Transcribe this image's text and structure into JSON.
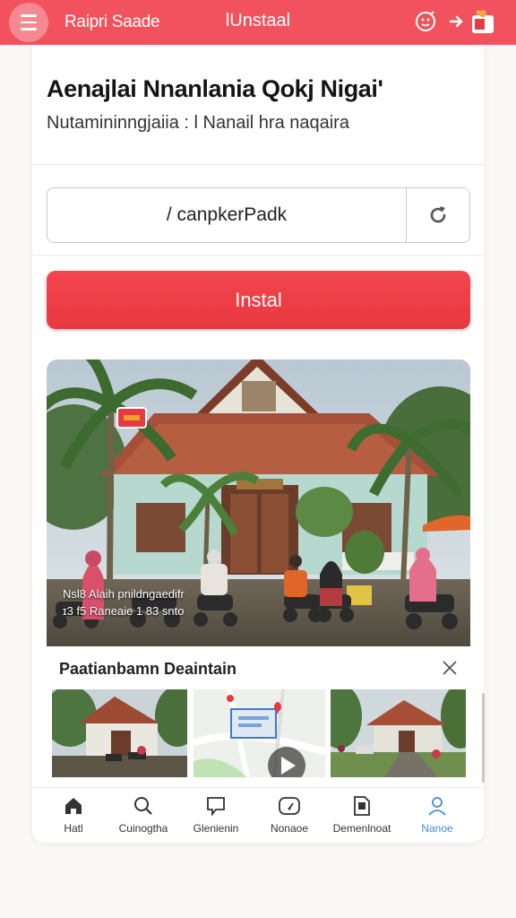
{
  "topbar": {
    "brand": "Raipri Saade",
    "title": "lUnstaal",
    "accent": "#f1525e",
    "icons": [
      "menu-icon",
      "assistant-icon",
      "share-arrow-icon",
      "gift-icon"
    ]
  },
  "headline": "Aenajlai Nnanlania Qokj Nigai'",
  "subhead": "Nutamininngjaiia : l Nanail hra naqaira",
  "code_field": {
    "value": "/ canpkerPadk",
    "refresh_icon": "refresh-icon"
  },
  "install_button": "Instal",
  "hero": {
    "sign_badge": "",
    "caption_line1": "Nsl8 Alaih pnildngaedifr",
    "caption_line2": "ɪ3 f5 Raneaie 1 83 snto"
  },
  "gallery": {
    "title": "Paatianbamn Deaintain",
    "close_icon": "close-icon",
    "thumbnails": [
      "house-photo",
      "map-with-play-icon",
      "street-photo"
    ]
  },
  "bottom_nav": [
    {
      "label": "Hatl",
      "icon": "home-icon",
      "active": false
    },
    {
      "label": "Cuinogtha",
      "icon": "search-icon",
      "active": false
    },
    {
      "label": "Glenienin",
      "icon": "chat-icon",
      "active": false
    },
    {
      "label": "Nonaoe",
      "icon": "gauge-icon",
      "active": false
    },
    {
      "label": "Demenlnoat",
      "icon": "document-icon",
      "active": false
    },
    {
      "label": "Nanoe",
      "icon": "profile-icon",
      "active": true
    }
  ],
  "colors": {
    "active": "#3d8fd8",
    "button": "#e8373f"
  }
}
